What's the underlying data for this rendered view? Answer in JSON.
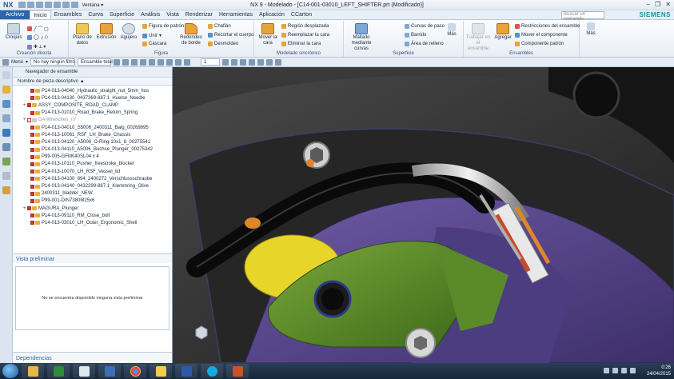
{
  "app": {
    "logo": "NX",
    "window_menu": "Ventana",
    "title": "NX 9 - Modelado - [C14-001-03010_LEFT_SHIFTER.prt (Modificado)]",
    "brand": "SIEMENS"
  },
  "menu": {
    "tabs": [
      "Archivo",
      "Inicio",
      "Ensambles",
      "Curva",
      "Superficie",
      "Análisis",
      "Vista",
      "Renderizar",
      "Herramientas",
      "Aplicación",
      "CCarton"
    ],
    "search_placeholder": "Buscar un comando"
  },
  "ribbon": {
    "groups": [
      {
        "label": "Creación directa",
        "buttons": [
          "Croquis"
        ]
      },
      {
        "label": "Figura",
        "buttons": [
          "Plano de datos",
          "Extrusión",
          "Agujero",
          "Figura de patrón",
          "Unir",
          "Cáscara",
          "Redondeo de borde",
          "Chaflán",
          "Recortar el cuerpo",
          "Desmoldeo"
        ]
      },
      {
        "label": "Modelado sincrónico",
        "buttons": [
          "Mover la cara",
          "Región desplazada",
          "Reemplazar la cara",
          "Eliminar la cara"
        ]
      },
      {
        "label": "Superficie",
        "buttons": [
          "Mallado mediante curvas",
          "Curvas de paso",
          "Barrido",
          "Área de relleno",
          "Más"
        ]
      },
      {
        "label": "Ensambles",
        "buttons": [
          "Trabajar en el ensamble",
          "Agregar",
          "Restricciones del ensamble",
          "Mover el componente",
          "Componente patrón",
          "Más"
        ]
      }
    ]
  },
  "filterbar": {
    "menu_label": "Menú",
    "filter": "No hay ningún filtro",
    "scope": "Ensamble total",
    "number": "1"
  },
  "navigator": {
    "title": "Navegador de ensamble",
    "column_header": "Nombre de pieza descriptivo",
    "rows": [
      {
        "text": "P14-013-04040_Hydraulic_straight_nut_5mm_hos",
        "greyed": false,
        "exp": ""
      },
      {
        "text": "P14-013-04130_0437369-887.1_Huelse_Needle",
        "greyed": false,
        "exp": ""
      },
      {
        "text": "ASSY_COMPOSITE_ROAD_CLAMP",
        "greyed": false,
        "exp": "+"
      },
      {
        "text": "P14-013-01010_Road_Brake_Return_Spring",
        "greyed": false,
        "exp": ""
      },
      {
        "text": "DA-Wrenches_n7",
        "greyed": true,
        "exp": "+"
      },
      {
        "text": "P14-013-04010_S5006_2400311_Balg_00269895",
        "greyed": false,
        "exp": ""
      },
      {
        "text": "P14-013-10061_RSF_LH_Brake_Chassis",
        "greyed": false,
        "exp": ""
      },
      {
        "text": "P14-013-04120_A5006_O-Ring-10x1_8_00275541",
        "greyed": false,
        "exp": ""
      },
      {
        "text": "P14-013-04110_A5006_Buchse_Plunger_00275342",
        "greyed": false,
        "exp": ""
      },
      {
        "text": "P99-005-GFM040SL04 x 4",
        "greyed": false,
        "exp": ""
      },
      {
        "text": "P14-013-10110_Pusher_freestroke_blocker",
        "greyed": false,
        "exp": ""
      },
      {
        "text": "P14-013-10070_LH_RSF_Vessel_lid",
        "greyed": false,
        "exp": ""
      },
      {
        "text": "P14-013-04100_894_2400272_Verschlussschraube",
        "greyed": false,
        "exp": ""
      },
      {
        "text": "P14-013-04140_0432299-887.1_Klemmring_Olive",
        "greyed": false,
        "exp": ""
      },
      {
        "text": "2400311_bladder_NEW",
        "greyed": false,
        "exp": ""
      },
      {
        "text": "P99-001-DIN7380M25x6",
        "greyed": false,
        "exp": ""
      },
      {
        "text": "MAGURA_Plunger",
        "greyed": false,
        "exp": "+"
      },
      {
        "text": "P14-013-09110_RM_Close_bolt",
        "greyed": false,
        "exp": ""
      },
      {
        "text": "P14-013-03010_LH_Outer_Ergonomic_Shell",
        "greyed": false,
        "exp": ""
      }
    ],
    "preview_title": "Vista preliminar",
    "preview_empty": "No se encuentra disponible ninguna vista preliminar",
    "dependencies_title": "Dependencias"
  },
  "taskbar": {
    "time": "0:26",
    "date": "24/04/2015"
  },
  "colors": {
    "accent": "#2b66a8",
    "purple_part": "#5a4a8c",
    "green_part": "#5a8a2a",
    "yellow_part": "#e7d52a"
  }
}
